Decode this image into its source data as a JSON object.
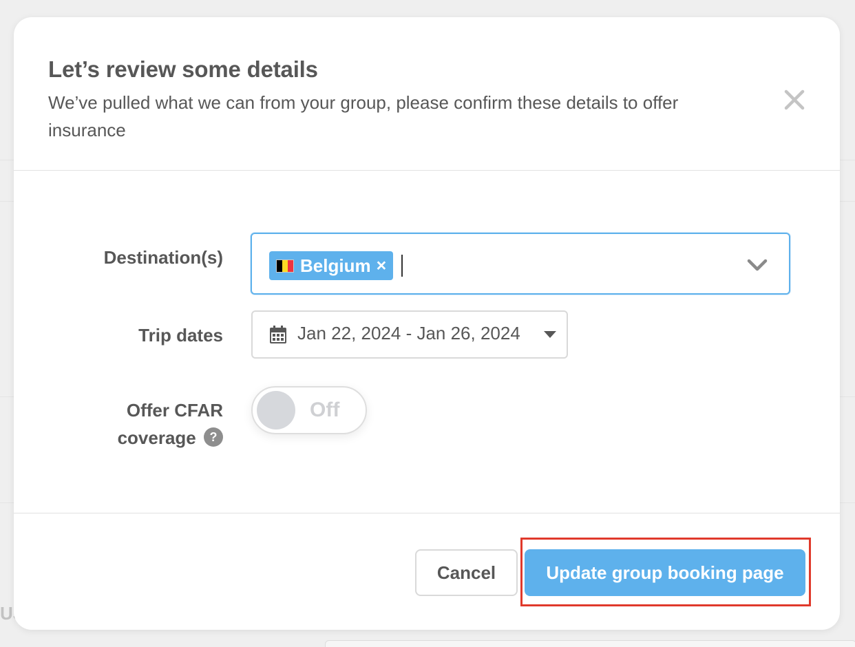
{
  "background": {
    "partial_text": "US"
  },
  "modal": {
    "title": "Let’s review some details",
    "subtitle": "We’ve pulled what we can from your group, please confirm these details to offer insurance",
    "close_icon": "close-icon"
  },
  "form": {
    "destination": {
      "label": "Destination(s)",
      "selected": [
        {
          "name": "Belgium",
          "flag_icon": "belgium-flag-icon",
          "remove_symbol": "×"
        }
      ],
      "dropdown_icon": "chevron-down-icon"
    },
    "trip_dates": {
      "label": "Trip dates",
      "value": "Jan 22, 2024 - Jan 26, 2024",
      "icon": "calendar-icon",
      "dropdown_icon": "caret-down-icon"
    },
    "cfar": {
      "label_line1": "Offer CFAR",
      "label_line2": "coverage",
      "help_symbol": "?",
      "toggle_state": "Off"
    }
  },
  "footer": {
    "cancel_label": "Cancel",
    "update_label": "Update group booking page"
  },
  "colors": {
    "accent": "#5eb1ec",
    "text": "#575757",
    "highlight": "#e0392b",
    "belgium_flag": [
      "#000000",
      "#fdda24",
      "#ef3340"
    ]
  }
}
